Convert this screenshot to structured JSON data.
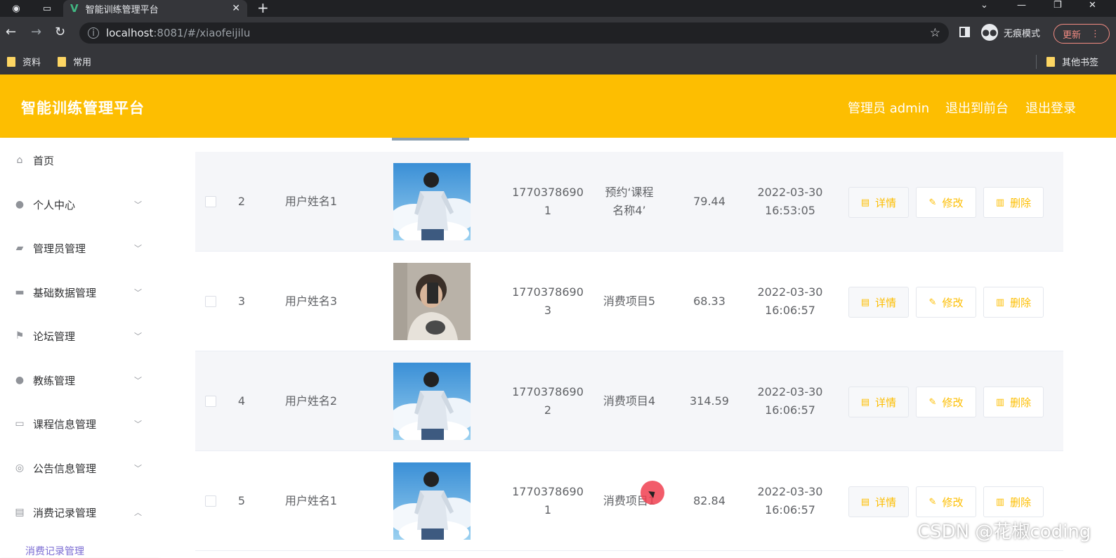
{
  "browser": {
    "tab_title": "智能训练管理平台",
    "url_host": "localhost",
    "url_rest": ":8081/#/xiaofeijilu",
    "incognito_label": "无痕模式",
    "update_label": "更新",
    "bookmarks": [
      "资料",
      "常用"
    ],
    "other_bookmarks": "其他书签"
  },
  "header": {
    "title": "智能训练管理平台",
    "admin_label": "管理员 admin",
    "front_label": "退出到前台",
    "logout_label": "退出登录"
  },
  "sidebar": {
    "items": [
      {
        "label": "首页",
        "icon": "home-icon"
      },
      {
        "label": "个人中心",
        "icon": "user-icon"
      },
      {
        "label": "管理员管理",
        "icon": "briefcase-icon"
      },
      {
        "label": "基础数据管理",
        "icon": "database-icon"
      },
      {
        "label": "论坛管理",
        "icon": "flag-icon"
      },
      {
        "label": "教练管理",
        "icon": "pin-icon"
      },
      {
        "label": "课程信息管理",
        "icon": "monitor-icon"
      },
      {
        "label": "公告信息管理",
        "icon": "gauge-icon"
      },
      {
        "label": "消费记录管理",
        "icon": "box-icon"
      }
    ],
    "sub_item": "消费记录管理"
  },
  "table": {
    "rows": [
      {
        "index": "2",
        "name": "用户姓名1",
        "phone_l1": "1770378690",
        "phone_l2": "1",
        "item_l1": "预约‘课程",
        "item_l2": "名称4’",
        "amount": "79.44",
        "date": "2022-03-30",
        "time": "16:53:05",
        "avatar": "cloud"
      },
      {
        "index": "3",
        "name": "用户姓名3",
        "phone_l1": "1770378690",
        "phone_l2": "3",
        "item_l1": "消费项目5",
        "item_l2": "",
        "amount": "68.33",
        "date": "2022-03-30",
        "time": "16:06:57",
        "avatar": "selfie"
      },
      {
        "index": "4",
        "name": "用户姓名2",
        "phone_l1": "1770378690",
        "phone_l2": "2",
        "item_l1": "消费项目4",
        "item_l2": "",
        "amount": "314.59",
        "date": "2022-03-30",
        "time": "16:06:57",
        "avatar": "cloud"
      },
      {
        "index": "5",
        "name": "用户姓名1",
        "phone_l1": "1770378690",
        "phone_l2": "1",
        "item_l1": "消费项目1",
        "item_l2": "",
        "amount": "82.84",
        "date": "2022-03-30",
        "time": "16:06:57",
        "avatar": "cloud"
      }
    ],
    "detail_label": "详情",
    "edit_label": "修改",
    "delete_label": "删除"
  },
  "watermark": "CSDN @花椒coding",
  "colors": {
    "accent": "#fdbe01",
    "chrome_dark": "#202124",
    "chrome": "#35363a"
  }
}
